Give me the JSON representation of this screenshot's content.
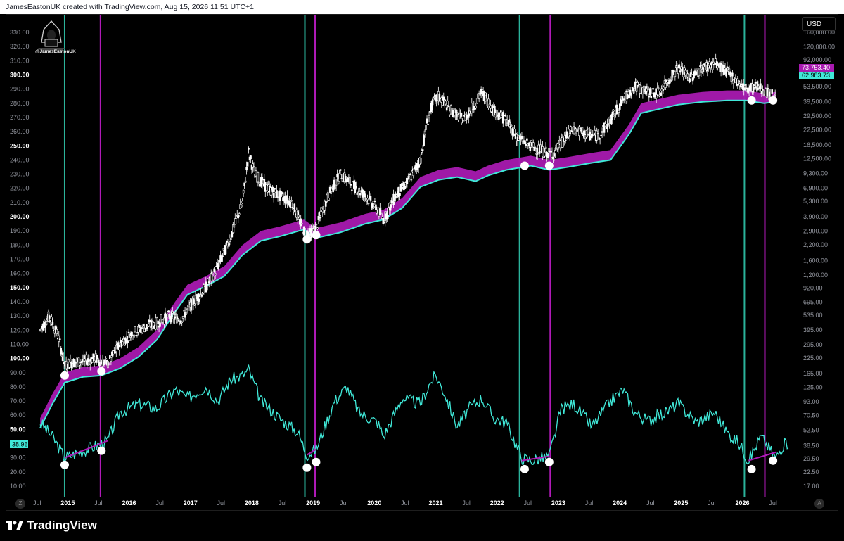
{
  "header": {
    "text": "JamesEastonUK created with TradingView.com, Aug 15, 2026 11:51 UTC+1"
  },
  "watermark": {
    "handle": "@JamesEastonUK"
  },
  "currency_button": {
    "label": "USD"
  },
  "footer": {
    "logo_text": "TradingView"
  },
  "corner": {
    "left": "Z",
    "right": "A"
  },
  "colors": {
    "bg": "#000000",
    "candle": "#ffffff",
    "band": "#a81ab0",
    "cyan": "#40e8d8",
    "vline_green": "#2bb39b",
    "vline_magenta": "#b01ab8",
    "marker": "#ffffff"
  },
  "chart_data": {
    "type": "line",
    "x_axis": {
      "labels": [
        "Jul",
        "2015",
        "Jul",
        "2016",
        "Jul",
        "2017",
        "Jul",
        "2018",
        "Jul",
        "2019",
        "Jul",
        "2020",
        "Jul",
        "2021",
        "Jul",
        "2022",
        "Jul",
        "2023",
        "Jul",
        "2024",
        "Jul",
        "2025",
        "Jul",
        "2026",
        "Jul"
      ],
      "bold": [
        "2015",
        "2016",
        "2017",
        "2018",
        "2019",
        "2020",
        "2021",
        "2022",
        "2023",
        "2024",
        "2025",
        "2026"
      ]
    },
    "left_axis": {
      "min": 10,
      "max": 330,
      "labels": [
        "330.00",
        "320.00",
        "310.00",
        "300.00",
        "290.00",
        "280.00",
        "270.00",
        "260.00",
        "250.00",
        "240.00",
        "230.00",
        "220.00",
        "210.00",
        "200.00",
        "190.00",
        "180.00",
        "170.00",
        "160.00",
        "150.00",
        "140.00",
        "130.00",
        "120.00",
        "110.00",
        "100.00",
        "90.00",
        "80.00",
        "70.00",
        "60.00",
        "50.00",
        "40.00",
        "30.00",
        "20.00",
        "10.00"
      ],
      "bold": [
        "300.00",
        "250.00",
        "200.00",
        "150.00",
        "100.00",
        "50.00"
      ]
    },
    "right_axis": {
      "scale": "log",
      "labels": [
        "160,000.00",
        "120,000.00",
        "92,000.00",
        "53,500.00",
        "39,500.00",
        "29,500.00",
        "22,500.00",
        "16,500.00",
        "12,500.00",
        "9,300.00",
        "6,900.00",
        "5,300.00",
        "3,900.00",
        "2,900.00",
        "2,200.00",
        "1,600.00",
        "1,200.00",
        "920.00",
        "695.00",
        "535.00",
        "395.00",
        "295.00",
        "225.00",
        "165.00",
        "125.00",
        "93.00",
        "70.50",
        "52.50",
        "38.50",
        "29.50",
        "22.50",
        "17.00"
      ]
    },
    "price_tags": [
      {
        "value": "73,753.40",
        "color": "#a81ab0"
      },
      {
        "value": "62,983.73",
        "color": "#40e8d8"
      }
    ],
    "oscillator_tag": {
      "value": "38.96",
      "color": "#40e8d8"
    },
    "vertical_lines": [
      {
        "date": "2015-01",
        "color": "green"
      },
      {
        "date": "2015-08",
        "color": "magenta"
      },
      {
        "date": "2018-12",
        "color": "green"
      },
      {
        "date": "2019-02",
        "color": "magenta"
      },
      {
        "date": "2022-06",
        "color": "green"
      },
      {
        "date": "2022-12",
        "color": "magenta"
      },
      {
        "date": "2026-02",
        "color": "green"
      },
      {
        "date": "2026-06",
        "color": "magenta"
      }
    ],
    "price_series": {
      "name": "",
      "points": [
        [
          2014.6,
          120
        ],
        [
          2014.75,
          130
        ],
        [
          2014.9,
          115
        ],
        [
          2015.0,
          95
        ],
        [
          2015.1,
          97
        ],
        [
          2015.3,
          98
        ],
        [
          2015.5,
          100
        ],
        [
          2015.7,
          96
        ],
        [
          2015.9,
          110
        ],
        [
          2016.1,
          118
        ],
        [
          2016.3,
          122
        ],
        [
          2016.5,
          125
        ],
        [
          2016.7,
          130
        ],
        [
          2016.9,
          128
        ],
        [
          2017.1,
          140
        ],
        [
          2017.3,
          150
        ],
        [
          2017.5,
          165
        ],
        [
          2017.7,
          185
        ],
        [
          2017.9,
          210
        ],
        [
          2018.0,
          245
        ],
        [
          2018.1,
          230
        ],
        [
          2018.3,
          220
        ],
        [
          2018.5,
          215
        ],
        [
          2018.7,
          210
        ],
        [
          2018.9,
          190
        ],
        [
          2019.0,
          188
        ],
        [
          2019.1,
          192
        ],
        [
          2019.3,
          215
        ],
        [
          2019.5,
          230
        ],
        [
          2019.7,
          222
        ],
        [
          2019.9,
          215
        ],
        [
          2020.1,
          205
        ],
        [
          2020.2,
          198
        ],
        [
          2020.4,
          215
        ],
        [
          2020.6,
          225
        ],
        [
          2020.8,
          240
        ],
        [
          2020.9,
          265
        ],
        [
          2021.0,
          280
        ],
        [
          2021.1,
          285
        ],
        [
          2021.3,
          275
        ],
        [
          2021.5,
          268
        ],
        [
          2021.7,
          280
        ],
        [
          2021.8,
          288
        ],
        [
          2022.0,
          275
        ],
        [
          2022.2,
          268
        ],
        [
          2022.4,
          255
        ],
        [
          2022.6,
          250
        ],
        [
          2022.8,
          246
        ],
        [
          2022.95,
          244
        ],
        [
          2023.1,
          252
        ],
        [
          2023.3,
          262
        ],
        [
          2023.5,
          258
        ],
        [
          2023.7,
          257
        ],
        [
          2023.9,
          268
        ],
        [
          2024.1,
          282
        ],
        [
          2024.3,
          292
        ],
        [
          2024.5,
          288
        ],
        [
          2024.7,
          287
        ],
        [
          2024.9,
          300
        ],
        [
          2025.0,
          305
        ],
        [
          2025.2,
          298
        ],
        [
          2025.4,
          305
        ],
        [
          2025.6,
          308
        ],
        [
          2025.8,
          302
        ],
        [
          2025.95,
          296
        ],
        [
          2026.1,
          290
        ],
        [
          2026.3,
          292
        ],
        [
          2026.5,
          286
        ],
        [
          2026.6,
          287
        ]
      ]
    },
    "band_series": {
      "name": "",
      "points": [
        [
          2014.6,
          58
        ],
        [
          2014.8,
          75
        ],
        [
          2015.0,
          90
        ],
        [
          2015.3,
          94
        ],
        [
          2015.6,
          95
        ],
        [
          2015.9,
          100
        ],
        [
          2016.2,
          108
        ],
        [
          2016.5,
          120
        ],
        [
          2016.8,
          140
        ],
        [
          2017.0,
          152
        ],
        [
          2017.3,
          158
        ],
        [
          2017.6,
          165
        ],
        [
          2017.9,
          180
        ],
        [
          2018.2,
          190
        ],
        [
          2018.5,
          193
        ],
        [
          2018.9,
          198
        ],
        [
          2019.1,
          192
        ],
        [
          2019.5,
          196
        ],
        [
          2019.9,
          202
        ],
        [
          2020.2,
          205
        ],
        [
          2020.5,
          213
        ],
        [
          2020.8,
          228
        ],
        [
          2021.1,
          233
        ],
        [
          2021.4,
          235
        ],
        [
          2021.7,
          232
        ],
        [
          2021.9,
          236
        ],
        [
          2022.2,
          240
        ],
        [
          2022.6,
          243
        ],
        [
          2022.9,
          240
        ],
        [
          2023.2,
          242
        ],
        [
          2023.6,
          245
        ],
        [
          2023.9,
          247
        ],
        [
          2024.2,
          265
        ],
        [
          2024.4,
          280
        ],
        [
          2024.7,
          283
        ],
        [
          2025.0,
          286
        ],
        [
          2025.4,
          288
        ],
        [
          2025.8,
          289
        ],
        [
          2026.1,
          289
        ],
        [
          2026.4,
          287
        ],
        [
          2026.6,
          288
        ]
      ]
    },
    "oscillator_series": {
      "name": "",
      "points": [
        [
          2014.6,
          55
        ],
        [
          2014.8,
          45
        ],
        [
          2015.0,
          30
        ],
        [
          2015.3,
          35
        ],
        [
          2015.6,
          40
        ],
        [
          2015.7,
          42
        ],
        [
          2015.9,
          62
        ],
        [
          2016.2,
          68
        ],
        [
          2016.5,
          65
        ],
        [
          2016.8,
          78
        ],
        [
          2017.0,
          72
        ],
        [
          2017.3,
          80
        ],
        [
          2017.5,
          70
        ],
        [
          2017.7,
          85
        ],
        [
          2017.9,
          88
        ],
        [
          2018.0,
          92
        ],
        [
          2018.2,
          70
        ],
        [
          2018.5,
          58
        ],
        [
          2018.8,
          48
        ],
        [
          2018.95,
          32
        ],
        [
          2019.1,
          36
        ],
        [
          2019.4,
          70
        ],
        [
          2019.6,
          80
        ],
        [
          2019.8,
          62
        ],
        [
          2020.1,
          55
        ],
        [
          2020.2,
          45
        ],
        [
          2020.5,
          72
        ],
        [
          2020.8,
          68
        ],
        [
          2020.95,
          82
        ],
        [
          2021.05,
          88
        ],
        [
          2021.2,
          75
        ],
        [
          2021.4,
          52
        ],
        [
          2021.6,
          65
        ],
        [
          2021.8,
          72
        ],
        [
          2022.0,
          58
        ],
        [
          2022.2,
          55
        ],
        [
          2022.45,
          30
        ],
        [
          2022.6,
          28
        ],
        [
          2022.9,
          31
        ],
        [
          2023.1,
          65
        ],
        [
          2023.3,
          68
        ],
        [
          2023.6,
          52
        ],
        [
          2023.9,
          70
        ],
        [
          2024.1,
          78
        ],
        [
          2024.3,
          62
        ],
        [
          2024.5,
          56
        ],
        [
          2024.8,
          62
        ],
        [
          2025.0,
          68
        ],
        [
          2025.3,
          55
        ],
        [
          2025.6,
          62
        ],
        [
          2025.8,
          48
        ],
        [
          2026.0,
          40
        ],
        [
          2026.15,
          28
        ],
        [
          2026.35,
          45
        ],
        [
          2026.6,
          30
        ],
        [
          2026.7,
          38
        ],
        [
          2026.8,
          41
        ]
      ]
    },
    "divergence_lines": [
      {
        "from": [
          2015.0,
          30
        ],
        "to": [
          2015.7,
          42
        ]
      },
      {
        "from": [
          2018.95,
          32
        ],
        "to": [
          2019.1,
          36
        ]
      },
      {
        "from": [
          2022.45,
          28
        ],
        "to": [
          2022.9,
          31
        ]
      },
      {
        "from": [
          2026.15,
          28
        ],
        "to": [
          2026.6,
          34
        ]
      }
    ],
    "markers": [
      [
        2015.0,
        88
      ],
      [
        2015.6,
        91
      ],
      [
        2018.95,
        184
      ],
      [
        2019.1,
        187
      ],
      [
        2022.5,
        236
      ],
      [
        2022.9,
        236
      ],
      [
        2026.2,
        282
      ],
      [
        2026.55,
        282
      ],
      [
        2015.0,
        25
      ],
      [
        2015.6,
        35
      ],
      [
        2018.95,
        23
      ],
      [
        2019.1,
        27
      ],
      [
        2022.5,
        22
      ],
      [
        2022.9,
        27
      ],
      [
        2026.2,
        22
      ],
      [
        2026.55,
        28
      ]
    ]
  }
}
